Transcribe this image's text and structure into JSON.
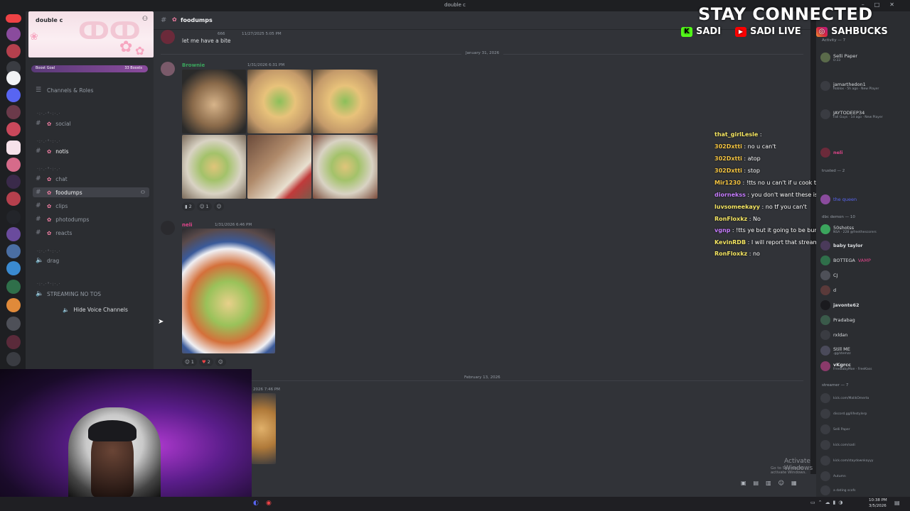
{
  "window": {
    "title": "double c"
  },
  "server": {
    "name": "double c",
    "boost_goal_label": "Boost Goal",
    "boost_count": "33 Boosts",
    "channels_and_roles": "Channels & Roles",
    "channels": [
      {
        "name": "social"
      },
      {
        "name": "notis"
      },
      {
        "name": "chat"
      },
      {
        "name": "foodumps"
      },
      {
        "name": "clips"
      },
      {
        "name": "photodumps"
      },
      {
        "name": "reacts"
      },
      {
        "name": "drag"
      }
    ],
    "category_streaming": "STREAMING NO TOS",
    "hide_voice": "Hide Voice Channels"
  },
  "chat": {
    "channel_name": "foodumps",
    "messages": [
      {
        "author": "",
        "time": "11/27/2025 5:05 PM",
        "text": "let me have a bite",
        "badge": "666"
      },
      {
        "author": "Brownie",
        "time": "1/31/2026 6:31 PM",
        "text": "",
        "reactions": [
          "2",
          "1"
        ]
      },
      {
        "author": "neli",
        "time": "1/31/2026 6:46 PM",
        "text": "",
        "reactions": [
          "1",
          "2"
        ]
      },
      {
        "author": "",
        "time": "2026 7:46 PM",
        "text": ""
      }
    ],
    "date_dividers": [
      "January 31, 2026",
      "February 13, 2026"
    ]
  },
  "overlay": {
    "headline": "STAY CONNECTED",
    "kick": "SADI",
    "youtube": "SADI LIVE",
    "instagram": "SAHBUCKS",
    "activate_windows": "Activate Windows",
    "activate_windows_sub": "Go to Settings to activate Windows."
  },
  "stream_chat": [
    {
      "user": "that_girlLesle",
      "text": "",
      "color": "#f5e663"
    },
    {
      "user": "302Dxtti",
      "text": "no u can't",
      "color": "#f5c542"
    },
    {
      "user": "302Dxtti",
      "text": "atop",
      "color": "#f5c542"
    },
    {
      "user": "302Dxtti",
      "text": "stop",
      "color": "#f5c542"
    },
    {
      "user": "Mir1230",
      "text": "!tts no u can't if u cook ts nobody eating ts Ong",
      "color": "#f5c542"
    },
    {
      "user": "diornekss",
      "text": "you don't want these issues",
      "color": "#c77dff"
    },
    {
      "user": "luvsomeekayy",
      "text": "no tf you can't",
      "color": "#f5e663"
    },
    {
      "user": "RonFloxkz",
      "text": "No",
      "color": "#f5e663"
    },
    {
      "user": "vgnp",
      "text": "!tts ye but it going to be bum",
      "color": "#c77dff"
    },
    {
      "user": "KevinRDB",
      "text": "I will report that stream",
      "color": "#f5e663"
    },
    {
      "user": "RonFloxkz",
      "text": "no",
      "color": "#f5e663"
    }
  ],
  "members": {
    "activity_header": "Activity — 7",
    "activities": [
      {
        "name": "Selli Paper",
        "sub": "0:33"
      },
      {
        "name": "jamarthedon1",
        "sub": "Roblox · 5h ago · New Player"
      },
      {
        "name": "JAYTODEEP34",
        "sub": "Fall Guys · 1d ago · New Player"
      }
    ],
    "trusted_header": "trusted — 2",
    "owner": "neli",
    "queen": "the queen",
    "dbc_header": "dbc demon — 10",
    "list": [
      {
        "name": "50shotss",
        "sub": "NSA · 228 @freethescorers"
      },
      {
        "name": "baby taylor",
        "sub": ""
      },
      {
        "name": "BOTTEGA",
        "sub": "VAMP"
      },
      {
        "name": "CJ",
        "sub": ""
      },
      {
        "name": "d",
        "sub": ""
      },
      {
        "name": "javonte62",
        "sub": ""
      },
      {
        "name": "Pradabag",
        "sub": ""
      },
      {
        "name": "rxldan",
        "sub": ""
      },
      {
        "name": "Still ME",
        "sub": ".gg/stemzz"
      },
      {
        "name": "vKgrcc",
        "sub": "FreeBabyMoe · FreeKass"
      }
    ],
    "streamer_header": "streamer — 7",
    "streamers": [
      {
        "name": "",
        "sub": "kick.com/MalikOmerta"
      },
      {
        "name": "",
        "sub": "discord.gg/lifestylerp"
      },
      {
        "name": "",
        "sub": "Selli Paper"
      },
      {
        "name": "",
        "sub": "kick.com/sadi"
      },
      {
        "name": "",
        "sub": "kick.com/staydownkayyy"
      },
      {
        "name": "",
        "sub": "Autumn"
      },
      {
        "name": "",
        "sub": "a dating scofs"
      }
    ]
  },
  "taskbar": {
    "time": "10:38 PM",
    "date": "3/5/2026"
  }
}
